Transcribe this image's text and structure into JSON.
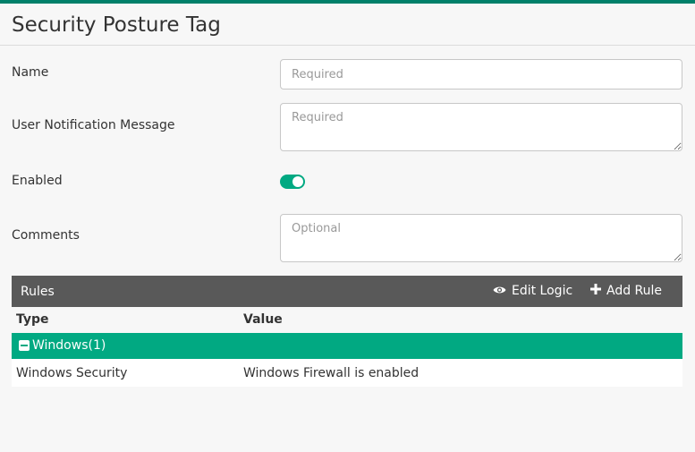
{
  "page": {
    "title": "Security Posture Tag"
  },
  "form": {
    "name_label": "Name",
    "name_placeholder": "Required",
    "message_label": "User Notification Message",
    "message_placeholder": "Required",
    "enabled_label": "Enabled",
    "enabled": true,
    "comments_label": "Comments",
    "comments_placeholder": "Optional"
  },
  "rules": {
    "title": "Rules",
    "edit_logic_label": "Edit Logic",
    "add_rule_label": "Add Rule",
    "columns": [
      "Type",
      "Value"
    ],
    "groups": [
      {
        "label": "Windows(1)",
        "rows": [
          {
            "type": "Windows Security",
            "value": "Windows Firewall is enabled"
          }
        ]
      }
    ]
  },
  "icons": {
    "edit_logic": "eye-icon",
    "add_rule": "plus-icon",
    "group_toggle": "minus-square-icon"
  },
  "colors": {
    "accent": "#01a982",
    "top_bar": "#01806a",
    "rules_bar": "#595959"
  }
}
